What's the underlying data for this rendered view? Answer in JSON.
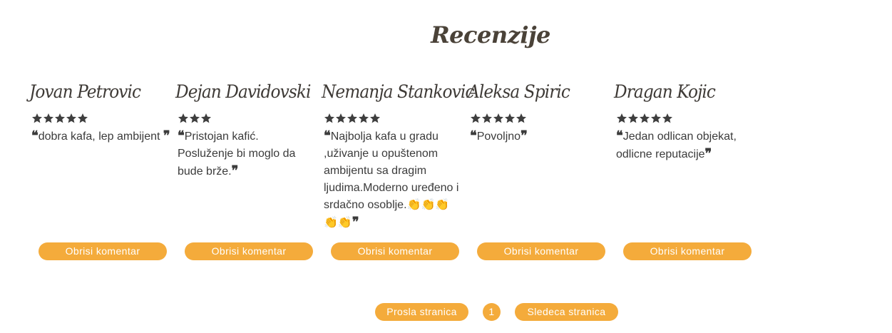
{
  "page": {
    "title": "Recenzije"
  },
  "reviews": [
    {
      "name": "Jovan Petrovic",
      "rating": 5,
      "comment": "dobra kafa, lep ambijent ",
      "delete_label": "Obrisi komentar"
    },
    {
      "name": "Dejan Davidovski",
      "rating": 3,
      "comment": "Pristojan kafić. Posluženje bi moglo da bude brže.",
      "delete_label": "Obrisi komentar"
    },
    {
      "name": "Nemanja Stankovic",
      "rating": 5,
      "comment": "Najbolja kafa u gradu ,uživanje u opuštenom ambijentu sa dragim ljudima.Moderno uređeno i srdačno osoblje.👏👏👏👏👏",
      "delete_label": "Obrisi komentar"
    },
    {
      "name": "Aleksa Spiric",
      "rating": 5,
      "comment": "Povoljno",
      "delete_label": "Obrisi komentar"
    },
    {
      "name": "Dragan Kojic",
      "rating": 5,
      "comment": "Jedan odlican objekat, odlicne reputacije",
      "delete_label": "Obrisi komentar"
    }
  ],
  "pagination": {
    "prev_label": "Prosla stranica",
    "current_page": "1",
    "next_label": "Sledeca stranica"
  },
  "colors": {
    "accent": "#f4ab3b",
    "star": "#3e3e3e",
    "text": "#3b3b3b"
  },
  "icons": {
    "star": "star-icon",
    "quote_open": "quote-open-icon",
    "quote_close": "quote-close-icon"
  }
}
